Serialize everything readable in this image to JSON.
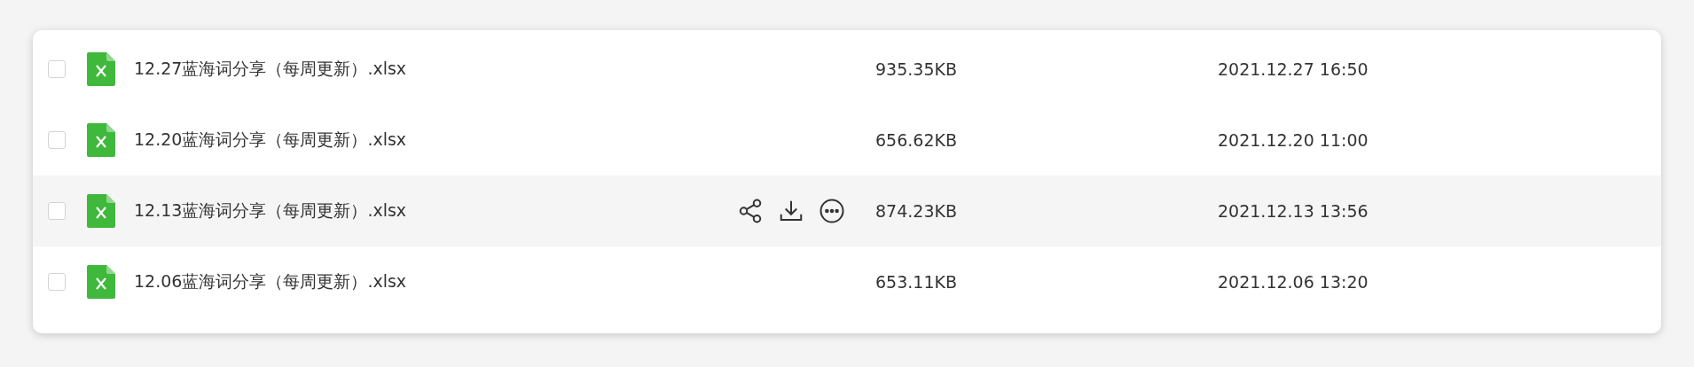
{
  "files": [
    {
      "name": "12.27蓝海词分享（每周更新）.xlsx",
      "size": "935.35KB",
      "date": "2021.12.27 16:50",
      "checked": false,
      "hovered": false
    },
    {
      "name": "12.20蓝海词分享（每周更新）.xlsx",
      "size": "656.62KB",
      "date": "2021.12.20 11:00",
      "checked": false,
      "hovered": false
    },
    {
      "name": "12.13蓝海词分享（每周更新）.xlsx",
      "size": "874.23KB",
      "date": "2021.12.13 13:56",
      "checked": false,
      "hovered": true
    },
    {
      "name": "12.06蓝海词分享（每周更新）.xlsx",
      "size": "653.11KB",
      "date": "2021.12.06 13:20",
      "checked": false,
      "hovered": false
    }
  ]
}
